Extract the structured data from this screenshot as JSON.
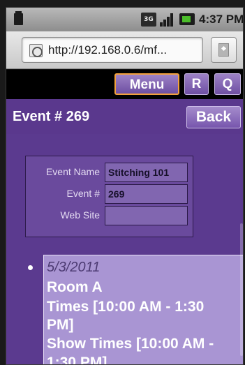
{
  "status_bar": {
    "network_label": "3G",
    "time": "4:37 PM"
  },
  "browser": {
    "url": "http://192.168.0.6/mf..."
  },
  "nav": {
    "menu_label": "Menu",
    "r_label": "R",
    "q_label": "Q"
  },
  "header": {
    "title": "Event # 269",
    "back_label": "Back"
  },
  "event_info": {
    "rows": [
      {
        "label": "Event Name",
        "value": "Stitching 101"
      },
      {
        "label": "Event #",
        "value": "269"
      },
      {
        "label": "Web Site",
        "value": ""
      }
    ]
  },
  "schedule": {
    "date": "5/3/2011",
    "room": "Room A",
    "times_line1": "Times [10:00 AM - 1:30",
    "times_line2": "PM]",
    "show_times_line1": "Show Times [10:00 AM -",
    "show_times_line2": "1:30 PM]"
  },
  "colors": {
    "page_bg": "#5b3a8f",
    "accent_border": "#f2a13b",
    "event_box_bg": "#a995d3"
  }
}
